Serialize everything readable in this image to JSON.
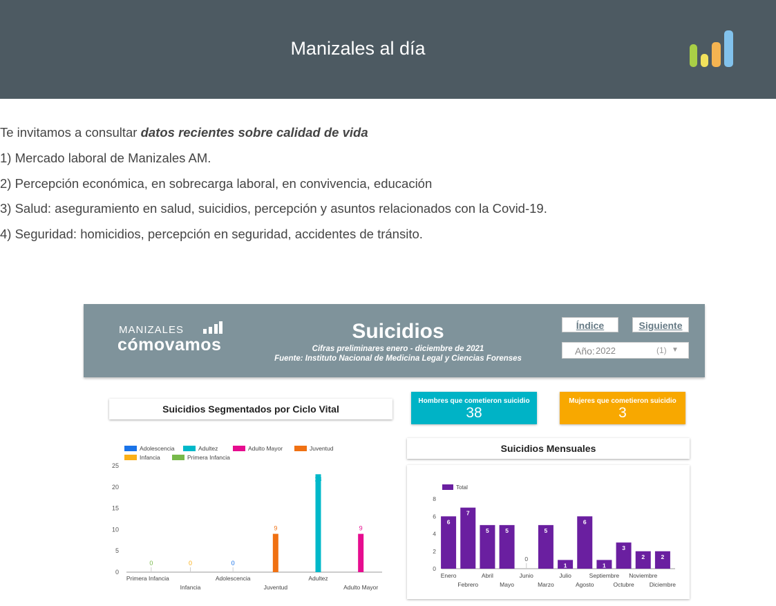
{
  "header": {
    "title": "Manizales al día"
  },
  "intro": {
    "lead_text": "Te invitamos a consultar ",
    "lead_bold": "datos recientes sobre calidad de vida",
    "items": [
      "1) Mercado laboral de Manizales AM.",
      "2) Percepción económica, en sobrecarga laboral, en convivencia, educación",
      "3) Salud: aseguramiento en salud, suicidios, percepción y asuntos relacionados con la Covid-19.",
      "4) Seguridad: homicidios, percepción en seguridad, accidentes de tránsito."
    ]
  },
  "report": {
    "brand_top": "MANIZALES",
    "brand_bottom": "cómovamos",
    "title": "Suicidios",
    "subtitle1": "Cifras preliminares enero - diciembre de 2021",
    "subtitle2": "Fuente: Instituto Nacional de Medicina Legal y Ciencias Forenses",
    "nav": {
      "index_label": "Índice",
      "next_label": "Siguiente"
    },
    "year_filter": {
      "label": "Año:",
      "value": "2022",
      "count": "(1)"
    },
    "kpis": {
      "men_label": "Hombres que cometieron suicidio",
      "men_value": "38",
      "men_color": "#00b3c6",
      "women_label": "Mujeres que cometieron suicidio",
      "women_value": "3",
      "women_color": "#f8a800"
    },
    "segment_title": "Suicidios Segmentados por Ciclo Vital",
    "monthly_title": "Suicidios Mensuales"
  },
  "chart_data": [
    {
      "type": "bar",
      "categories": [
        "Primera Infancia",
        "Infancia",
        "Adolescencia",
        "Juventud",
        "Adultez",
        "Adulto Mayor"
      ],
      "series": [
        {
          "name": "Primera Infancia",
          "category": "Primera Infancia",
          "value": 0,
          "color": "#77b94a"
        },
        {
          "name": "Infancia",
          "category": "Infancia",
          "value": 0,
          "color": "#fbb017"
        },
        {
          "name": "Adolescencia",
          "category": "Adolescencia",
          "value": 0,
          "color": "#1a73e8"
        },
        {
          "name": "Juventud",
          "category": "Juventud",
          "value": 9,
          "color": "#f07113"
        },
        {
          "name": "Adultez",
          "category": "Adultez",
          "value": 23,
          "color": "#00b8c9"
        },
        {
          "name": "Adulto Mayor",
          "category": "Adulto Mayor",
          "value": 9,
          "color": "#e60d8f"
        }
      ],
      "legend_order": [
        "Adolescencia",
        "Adultez",
        "Adulto Mayor",
        "Juventud",
        "Infancia",
        "Primera Infancia"
      ],
      "yticks": [
        0,
        5,
        10,
        15,
        20,
        25
      ],
      "ylim": [
        0,
        25
      ],
      "legend": "top-left"
    },
    {
      "type": "bar",
      "categories": [
        "Enero",
        "Febrero",
        "Abril",
        "Mayo",
        "Junio",
        "Marzo",
        "Julio",
        "Agosto",
        "Septiembre",
        "Octubre",
        "Noviembre",
        "Diciembre"
      ],
      "series": [
        {
          "name": "Total",
          "values": [
            6,
            7,
            5,
            5,
            0,
            5,
            1,
            6,
            1,
            3,
            2,
            2
          ],
          "color": "#6a1fa0"
        }
      ],
      "yticks": [
        0,
        2,
        4,
        6,
        8
      ],
      "ylim": [
        0,
        8
      ],
      "legend": "top-left"
    }
  ]
}
